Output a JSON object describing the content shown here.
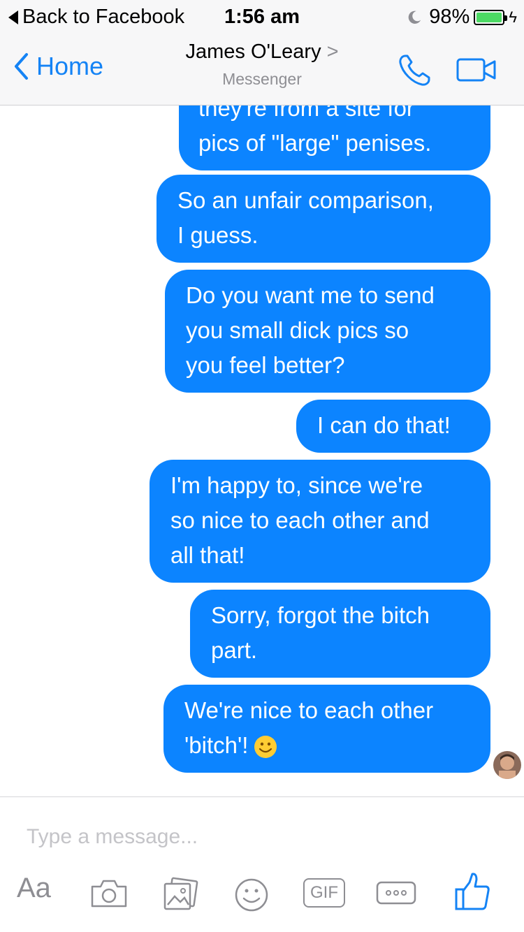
{
  "status_bar": {
    "back_label": "Back to Facebook",
    "time": "1:56 am",
    "battery_percent": "98%"
  },
  "nav": {
    "home_label": "Home",
    "contact_name": "James O'Leary",
    "contact_chevron": ">",
    "app_label": "Messenger"
  },
  "messages": [
    {
      "lines": [
        "they're from a site for",
        "pics of \"large\" penises."
      ]
    },
    {
      "lines": [
        "So an unfair comparison,",
        "I guess."
      ]
    },
    {
      "lines": [
        "Do you want me to send",
        "you small dick pics so",
        "you feel better?"
      ]
    },
    {
      "lines": [
        "I can do that!"
      ]
    },
    {
      "lines": [
        "I'm happy to, since we're",
        "so nice to each other and",
        "all that!"
      ]
    },
    {
      "lines": [
        "Sorry, forgot the bitch",
        "part."
      ]
    },
    {
      "lines": [
        "We're nice to each other",
        "'bitch'!"
      ]
    }
  ],
  "composer": {
    "placeholder": "Type a message...",
    "text_tool_label": "Aa",
    "gif_label": "GIF"
  },
  "colors": {
    "accent": "#1483f5",
    "bubble": "#0c84ff"
  },
  "icons": [
    "back-arrow-icon",
    "moon-icon",
    "battery-icon",
    "chevron-left-icon",
    "phone-icon",
    "video-camera-icon",
    "smiley-emoji-icon",
    "camera-icon",
    "photo-gallery-icon",
    "emoji-icon",
    "more-icon",
    "thumbs-up-icon"
  ]
}
